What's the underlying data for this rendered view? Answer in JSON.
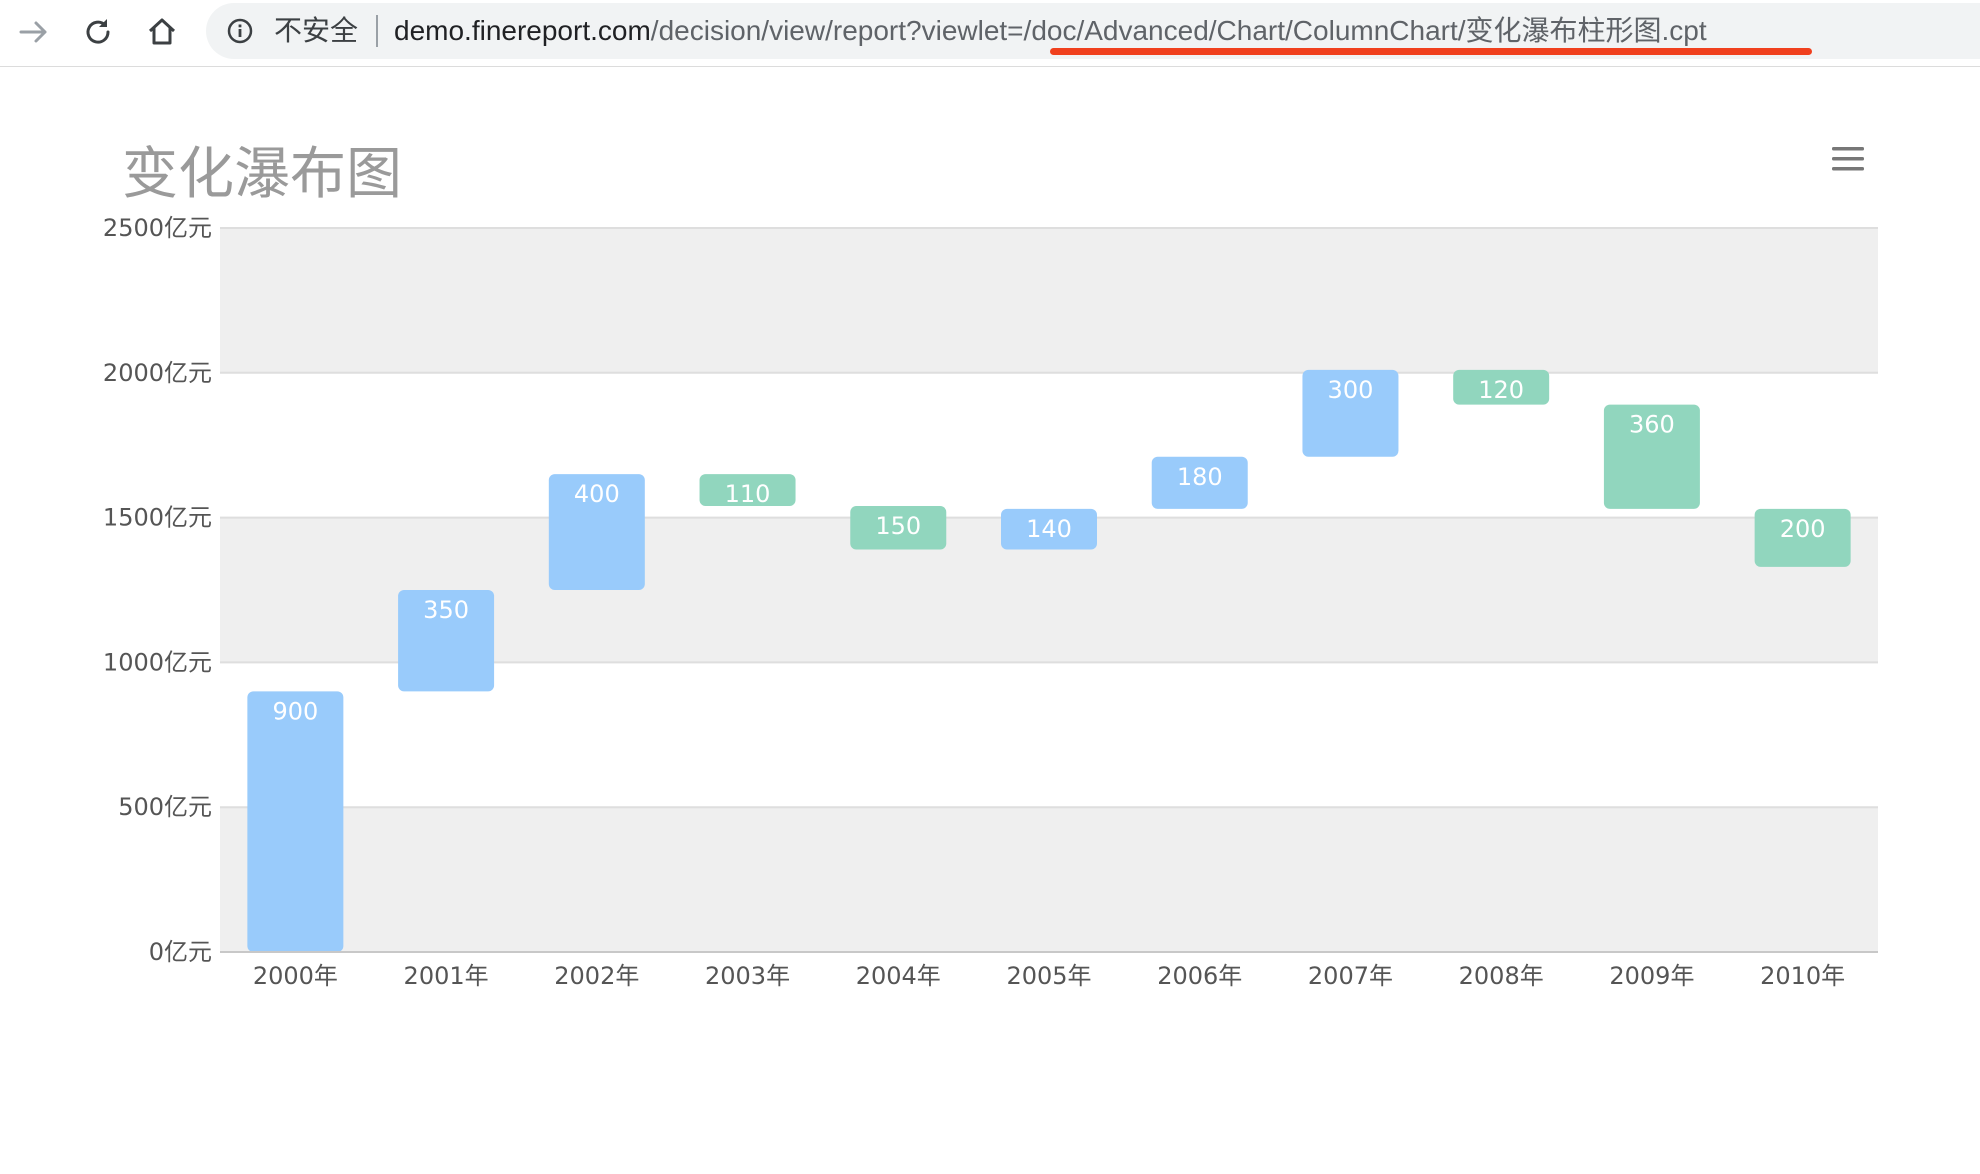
{
  "browser": {
    "security_label": "不安全",
    "url_host": "demo.finereport.com",
    "url_path": "/decision/view/report?viewlet=/doc/Advanced/Chart/ColumnChart/变化瀑布柱形图.cpt",
    "icons": [
      "forward-arrow-icon",
      "reload-icon",
      "home-icon",
      "info-icon"
    ]
  },
  "menu_icon": "hamburger-menu-icon",
  "colors": {
    "increase": "#99cbfb",
    "decrease": "#91d6be",
    "band": "#efefef",
    "url_highlight": "#f0401e"
  },
  "chart_data": {
    "type": "bar",
    "subtype": "waterfall",
    "title": "变化瀑布图",
    "xlabel": "",
    "ylabel": "",
    "unit": "亿元",
    "categories": [
      "2000年",
      "2001年",
      "2002年",
      "2003年",
      "2004年",
      "2005年",
      "2006年",
      "2007年",
      "2008年",
      "2009年",
      "2010年"
    ],
    "values": [
      900,
      350,
      400,
      -110,
      -150,
      140,
      180,
      300,
      -120,
      -360,
      -200
    ],
    "labels": [
      "900",
      "350",
      "400",
      "110",
      "150",
      "140",
      "180",
      "300",
      "120",
      "360",
      "200"
    ],
    "ylim": [
      0,
      2500
    ],
    "yticks": [
      0,
      500,
      1000,
      1500,
      2000,
      2500
    ],
    "ytick_labels": [
      "0亿元",
      "500亿元",
      "1000亿元",
      "1500亿元",
      "2000亿元",
      "2500亿元"
    ],
    "grid": true,
    "alternating_bands": true,
    "legend": "none"
  }
}
